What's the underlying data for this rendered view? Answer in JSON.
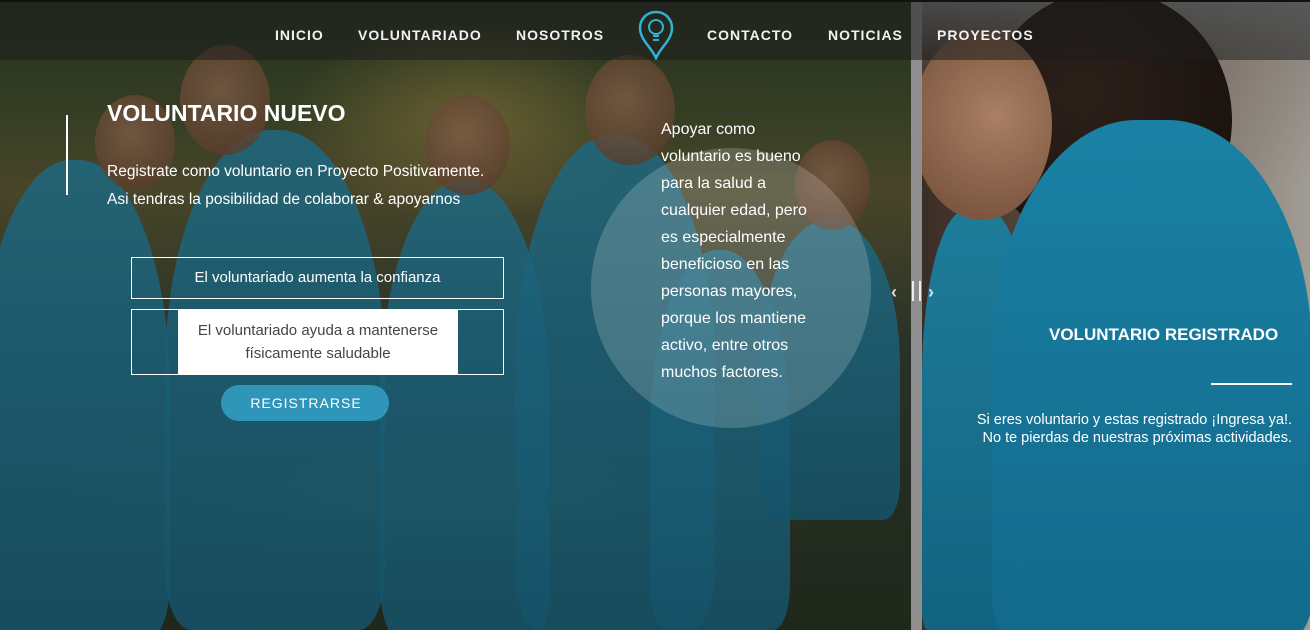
{
  "nav": {
    "items_left": [
      "INICIO",
      "VOLUNTARIADO",
      "NOSOTROS"
    ],
    "items_right": [
      "CONTACTO",
      "NOTICIAS",
      "PROYECTOS"
    ],
    "logo_icon": "lightbulb-pin-icon"
  },
  "hero": {
    "title": "VOLUNTARIO NUEVO",
    "text_line1": "Registrate como voluntario en Proyecto Positivamente.",
    "text_line2": "Asi tendras la posibilidad de colaborar & apoyarnos",
    "benefit1": "El voluntariado aumenta la confianza",
    "benefit2": "El voluntariado ayuda a mantenerse físicamente saludable",
    "button_label": "REGISTRARSE",
    "circle_text": "Apoyar como voluntario es bueno para la salud a cualquier edad, pero es especialmente beneficioso en las personas mayores, porque los mantiene activo, entre otros muchos factores."
  },
  "registered": {
    "title": "VOLUNTARIO REGISTRADO",
    "text_line1": "Si eres voluntario y estas registrado ¡Ingresa ya!.",
    "text_line2": "No te pierdas de nuestras próximas actividades."
  },
  "slider": {
    "left_arrow": "‹",
    "right_arrow": "›"
  },
  "colors": {
    "accent": "#2f96b9",
    "shirt": "#22a6d3"
  }
}
